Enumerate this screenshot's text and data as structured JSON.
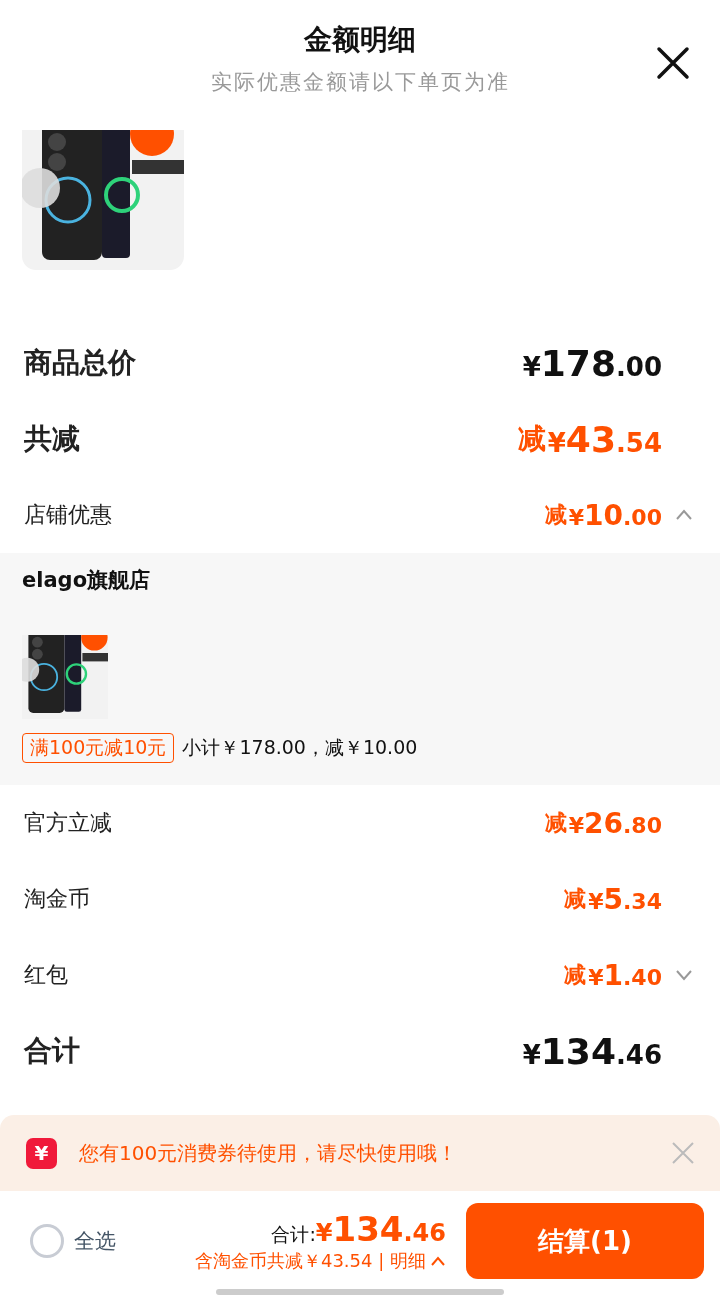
{
  "header": {
    "title": "金额明细",
    "subtitle": "实际优惠金额请以下单页为准"
  },
  "rows": [
    {
      "kind": "total",
      "label": "商品总价",
      "price": {
        "symbol": "¥",
        "main": "178",
        "fraction": ".00"
      }
    },
    {
      "kind": "saving_total",
      "label": "共减",
      "minus": "减",
      "price": {
        "symbol": "¥",
        "main": "43",
        "fraction": ".54"
      }
    },
    {
      "kind": "discount",
      "label": "店铺优惠",
      "minus": "减",
      "price": {
        "symbol": "¥",
        "main": "10",
        "fraction": ".00"
      },
      "expanded": true,
      "detail": {
        "store": "elago旗舰店",
        "tag": "满100元减10元",
        "summary": "小计￥178.00，减￥10.00"
      }
    },
    {
      "kind": "discount",
      "label": "官方立减",
      "minus": "减",
      "price": {
        "symbol": "¥",
        "main": "26",
        "fraction": ".80"
      }
    },
    {
      "kind": "discount",
      "label": "淘金币",
      "minus": "减",
      "price": {
        "symbol": "¥",
        "main": "5",
        "fraction": ".34"
      }
    },
    {
      "kind": "discount",
      "label": "红包",
      "minus": "减",
      "price": {
        "symbol": "¥",
        "main": "1",
        "fraction": ".40"
      },
      "expanded": false
    },
    {
      "kind": "total",
      "label": "合计",
      "price": {
        "symbol": "¥",
        "main": "134",
        "fraction": ".46"
      }
    }
  ],
  "banner": {
    "badge": "¥",
    "text": "您有100元消费券待使用，请尽快使用哦！"
  },
  "footer": {
    "select_all": {
      "label": "全选",
      "checked": false
    },
    "total_label": "合计:",
    "total": {
      "symbol": "¥",
      "main": "134",
      "fraction": ".46"
    },
    "savings": "含淘金币共减￥43.54 | 明细",
    "checkout": "结算(1)"
  }
}
